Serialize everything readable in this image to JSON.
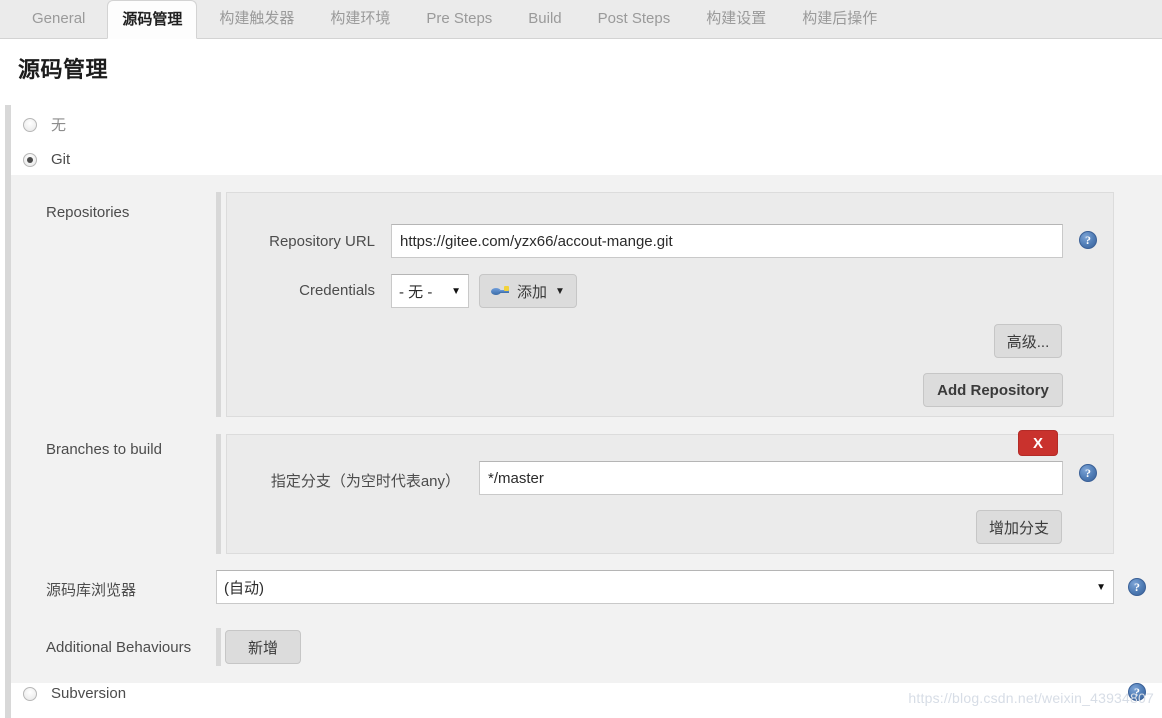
{
  "tabs": [
    {
      "label": "General",
      "active": false
    },
    {
      "label": "源码管理",
      "active": true
    },
    {
      "label": "构建触发器",
      "active": false
    },
    {
      "label": "构建环境",
      "active": false
    },
    {
      "label": "Pre Steps",
      "active": false
    },
    {
      "label": "Build",
      "active": false
    },
    {
      "label": "Post Steps",
      "active": false
    },
    {
      "label": "构建设置",
      "active": false
    },
    {
      "label": "构建后操作",
      "active": false
    }
  ],
  "page": {
    "title": "源码管理"
  },
  "scm_options": {
    "none_label": "无",
    "git_label": "Git",
    "subversion_label": "Subversion",
    "selected": "Git"
  },
  "repositories": {
    "section_label": "Repositories",
    "url_label": "Repository URL",
    "url_value": "https://gitee.com/yzx66/accout-mange.git",
    "credentials_label": "Credentials",
    "credentials_value": "- 无 -",
    "add_credentials_label": "添加",
    "advanced_label": "高级...",
    "add_repository_label": "Add Repository"
  },
  "branches": {
    "section_label": "Branches to build",
    "branch_label": "指定分支（为空时代表any）",
    "branch_value": "*/master",
    "delete_label": "X",
    "add_branch_label": "增加分支"
  },
  "repo_browser": {
    "label": "源码库浏览器",
    "value": "(自动)"
  },
  "additional_behaviours": {
    "label": "Additional Behaviours",
    "add_label": "新增"
  },
  "icons": {
    "help": "?",
    "caret_down": "▼"
  },
  "watermark": "https://blog.csdn.net/weixin_43934807",
  "colors": {
    "accent_red": "#c9322d",
    "help_blue": "#4f7cb5",
    "panel": "#ebebeb",
    "outer_panel": "#f2f2f2"
  }
}
